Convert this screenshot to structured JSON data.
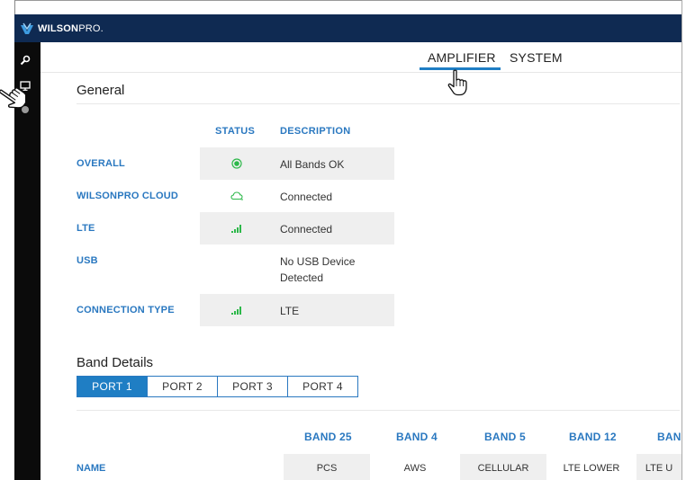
{
  "brand": {
    "name_bold": "WILSON",
    "name_thin": "PRO",
    "suffix": "."
  },
  "main_tabs": [
    {
      "label": "AMPLIFIER",
      "active": true
    },
    {
      "label": "SYSTEM",
      "active": false
    }
  ],
  "general": {
    "title": "General",
    "columns": {
      "status": "STATUS",
      "description": "DESCRIPTION"
    },
    "rows": [
      {
        "label": "OVERALL",
        "status_icon": "status-ok-icon",
        "description": "All Bands OK"
      },
      {
        "label": "WILSONPRO CLOUD",
        "status_icon": "cloud-icon",
        "description": "Connected"
      },
      {
        "label": "LTE",
        "status_icon": "signal-icon",
        "description": "Connected"
      },
      {
        "label": "USB",
        "status_icon": "",
        "description_line1": "No USB Device",
        "description_line2": "Detected"
      },
      {
        "label": "CONNECTION TYPE",
        "status_icon": "signal-icon",
        "description": "LTE"
      }
    ]
  },
  "band_details": {
    "title": "Band Details",
    "port_tabs": [
      "PORT 1",
      "PORT 2",
      "PORT 3",
      "PORT 4"
    ],
    "active_port": "PORT 1",
    "bands": [
      "BAND 25",
      "BAND 4",
      "BAND 5",
      "BAND 12",
      "BAN"
    ],
    "name_label": "NAME",
    "names": [
      "PCS",
      "AWS",
      "CELLULAR",
      "LTE LOWER",
      "LTE U"
    ]
  },
  "colors": {
    "topbar": "#0f2a52",
    "accent": "#2a78c0",
    "active_tab": "#1f7ec4",
    "status_green": "#2db84a",
    "cell_gray": "#efefef",
    "sidebar": "#0b0b0b"
  }
}
